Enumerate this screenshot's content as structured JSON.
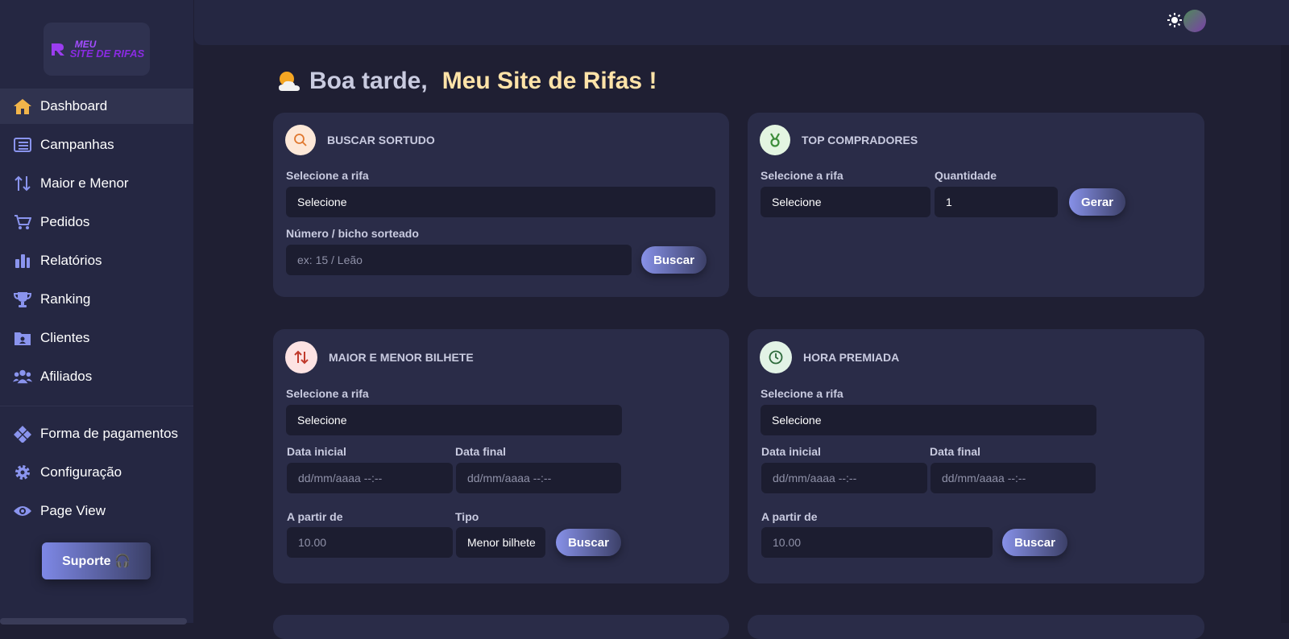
{
  "logo": {
    "line1": "MEU",
    "line2": "SITE DE RIFAS"
  },
  "sidebar": {
    "items": [
      {
        "label": "Dashboard",
        "icon": "home-icon"
      },
      {
        "label": "Campanhas",
        "icon": "list-icon"
      },
      {
        "label": "Maior e Menor",
        "icon": "sort-arrows-icon"
      },
      {
        "label": "Pedidos",
        "icon": "cart-icon"
      },
      {
        "label": "Relatórios",
        "icon": "bar-chart-icon"
      },
      {
        "label": "Ranking",
        "icon": "trophy-icon"
      },
      {
        "label": "Clientes",
        "icon": "user-folder-icon"
      },
      {
        "label": "Afiliados",
        "icon": "users-icon"
      }
    ],
    "items2": [
      {
        "label": "Forma de pagamentos",
        "icon": "payment-icon"
      },
      {
        "label": "Configuração",
        "icon": "gear-icon"
      },
      {
        "label": "Page View",
        "icon": "eye-icon"
      }
    ],
    "support_label": "Suporte 🎧"
  },
  "greeting": {
    "hello": "Boa tarde,",
    "name": "Meu Site de Rifas !"
  },
  "cards": {
    "buscar": {
      "title": "BUSCAR SORTUDO",
      "rifa_label": "Selecione a rifa",
      "rifa_value": "Selecione",
      "numero_label": "Número / bicho sorteado",
      "numero_placeholder": "ex: 15 / Leão",
      "button": "Buscar"
    },
    "top": {
      "title": "TOP COMPRADORES",
      "rifa_label": "Selecione a rifa",
      "rifa_value": "Selecione",
      "qtd_label": "Quantidade",
      "qtd_value": "1",
      "button": "Gerar"
    },
    "maior": {
      "title": "MAIOR E MENOR BILHETE",
      "rifa_label": "Selecione a rifa",
      "rifa_value": "Selecione",
      "ini_label": "Data inicial",
      "ini_placeholder": "dd/mm/aaaa --:--",
      "fim_label": "Data final",
      "fim_placeholder": "dd/mm/aaaa --:--",
      "apartir_label": "A partir de",
      "apartir_placeholder": "10.00",
      "tipo_label": "Tipo",
      "tipo_value": "Menor bilhete",
      "button": "Buscar"
    },
    "hora": {
      "title": "HORA PREMIADA",
      "rifa_label": "Selecione a rifa",
      "rifa_value": "Selecione",
      "ini_label": "Data inicial",
      "ini_placeholder": "dd/mm/aaaa --:--",
      "fim_label": "Data final",
      "fim_placeholder": "dd/mm/aaaa --:--",
      "apartir_label": "A partir de",
      "apartir_placeholder": "10.00",
      "button": "Buscar"
    }
  }
}
